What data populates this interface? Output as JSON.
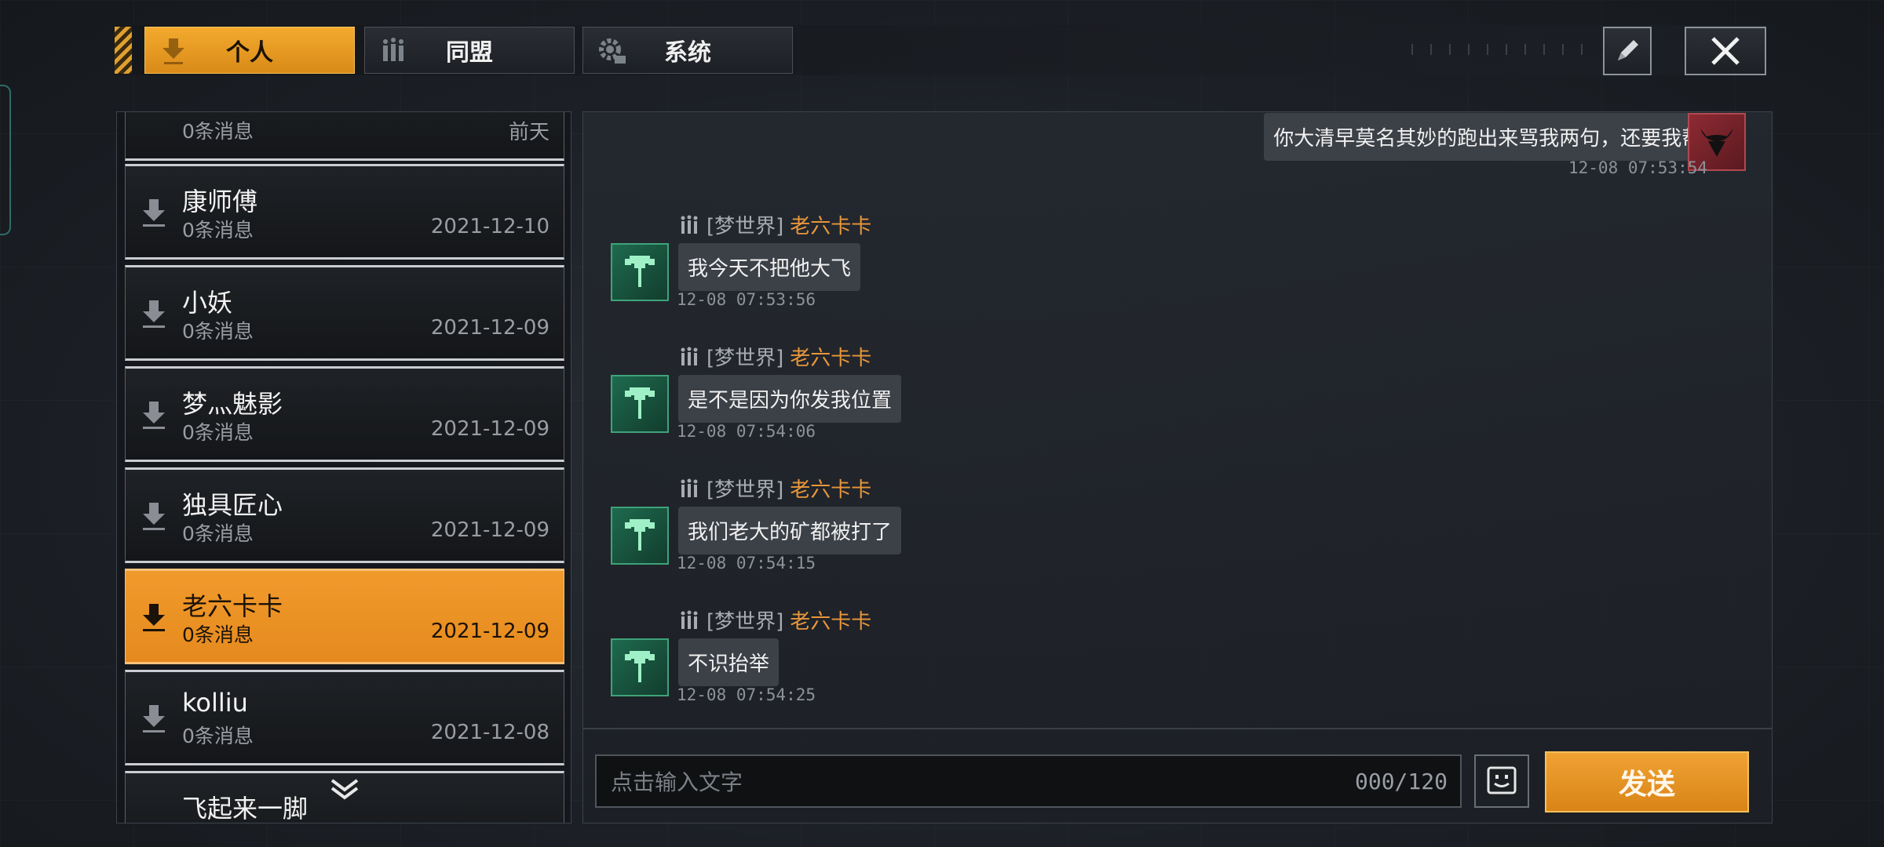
{
  "tabs": [
    {
      "label": "个人",
      "icon": "download-arrow-icon",
      "active": true
    },
    {
      "label": "同盟",
      "icon": "alliance-icon",
      "active": false
    },
    {
      "label": "系统",
      "icon": "gear-icon",
      "active": false
    }
  ],
  "contacts": [
    {
      "name": "",
      "count": "0条消息",
      "date": "前天",
      "active": false
    },
    {
      "name": "康师傅",
      "count": "0条消息",
      "date": "2021-12-10",
      "active": false
    },
    {
      "name": "小妖",
      "count": "0条消息",
      "date": "2021-12-09",
      "active": false
    },
    {
      "name": "梦灬魅影",
      "count": "0条消息",
      "date": "2021-12-09",
      "active": false
    },
    {
      "name": "独具匠心",
      "count": "0条消息",
      "date": "2021-12-09",
      "active": false
    },
    {
      "name": "老六卡卡",
      "count": "0条消息",
      "date": "2021-12-09",
      "active": true
    },
    {
      "name": "kolliu",
      "count": "0条消息",
      "date": "2021-12-08",
      "active": false
    },
    {
      "name": "飞起来一脚",
      "count": "",
      "date": "",
      "active": false
    }
  ],
  "chat": {
    "outgoing": {
      "text": "你大清早莫名其妙的跑出来骂我两句，还要我帮你?",
      "time": "12-08 07:53:54"
    },
    "incoming": [
      {
        "server": "[梦世界]",
        "sender": "老六卡卡",
        "text": "我今天不把他大飞",
        "time": "12-08 07:53:56"
      },
      {
        "server": "[梦世界]",
        "sender": "老六卡卡",
        "text": "是不是因为你发我位置",
        "time": "12-08 07:54:06"
      },
      {
        "server": "[梦世界]",
        "sender": "老六卡卡",
        "text": "我们老大的矿都被打了",
        "time": "12-08 07:54:15"
      },
      {
        "server": "[梦世界]",
        "sender": "老六卡卡",
        "text": "不识抬举",
        "time": "12-08 07:54:25"
      }
    ]
  },
  "input": {
    "placeholder": "点击输入文字",
    "counter": "000/120"
  },
  "send_label": "发送",
  "colors": {
    "accent": "#f0a233",
    "sender": "#e8973a",
    "panel": "#24282f"
  }
}
